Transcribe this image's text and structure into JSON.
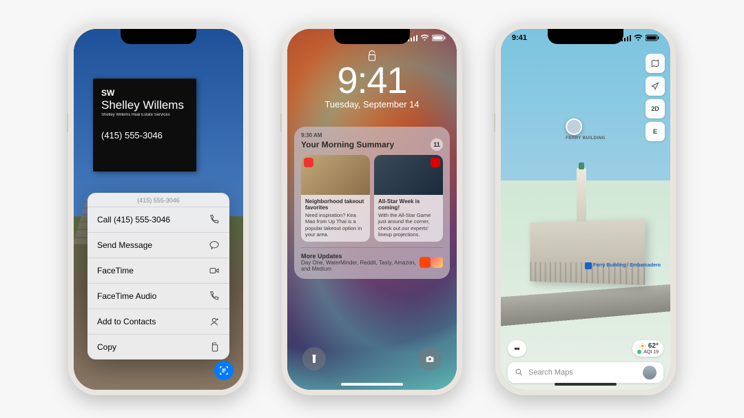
{
  "phone1": {
    "sign": {
      "initials": "SW",
      "name": "Shelley Willems",
      "subtitle": "Shelley Willems\nReal Estate Services",
      "phone": "(415) 555-3046"
    },
    "menu": {
      "header": "(415) 555-3046",
      "items": [
        {
          "label": "Call (415) 555-3046",
          "icon": "phone"
        },
        {
          "label": "Send Message",
          "icon": "message"
        },
        {
          "label": "FaceTime",
          "icon": "video"
        },
        {
          "label": "FaceTime Audio",
          "icon": "phone"
        },
        {
          "label": "Add to Contacts",
          "icon": "contact"
        },
        {
          "label": "Copy",
          "icon": "copy"
        }
      ]
    }
  },
  "phone2": {
    "time": "9:41",
    "date": "Tuesday, September 14",
    "summary": {
      "meta": "9:30 AM",
      "title": "Your Morning Summary",
      "count": "11",
      "cards": [
        {
          "title": "Neighborhood takeout favorites",
          "text": "Need inspiration? Kea Mao from Up Thai is a popular takeout option in your area."
        },
        {
          "title": "All-Star Week is coming!",
          "text": "With the All-Star Game just around the corner, check out our experts' lineup projections."
        }
      ],
      "more": {
        "title": "More Updates",
        "text": "Day One, WaterMinder, Reddit, Tasty, Amazon, and Medium"
      }
    }
  },
  "phone3": {
    "status_time": "9:41",
    "pin_label": "FERRY BUILDING",
    "station": "Ferry Building / Embarcadero",
    "controls": {
      "mode_2d": "2D",
      "compass": "E"
    },
    "weather": {
      "temp": "62°",
      "aqi": "AQI 19"
    },
    "search_placeholder": "Search Maps"
  }
}
